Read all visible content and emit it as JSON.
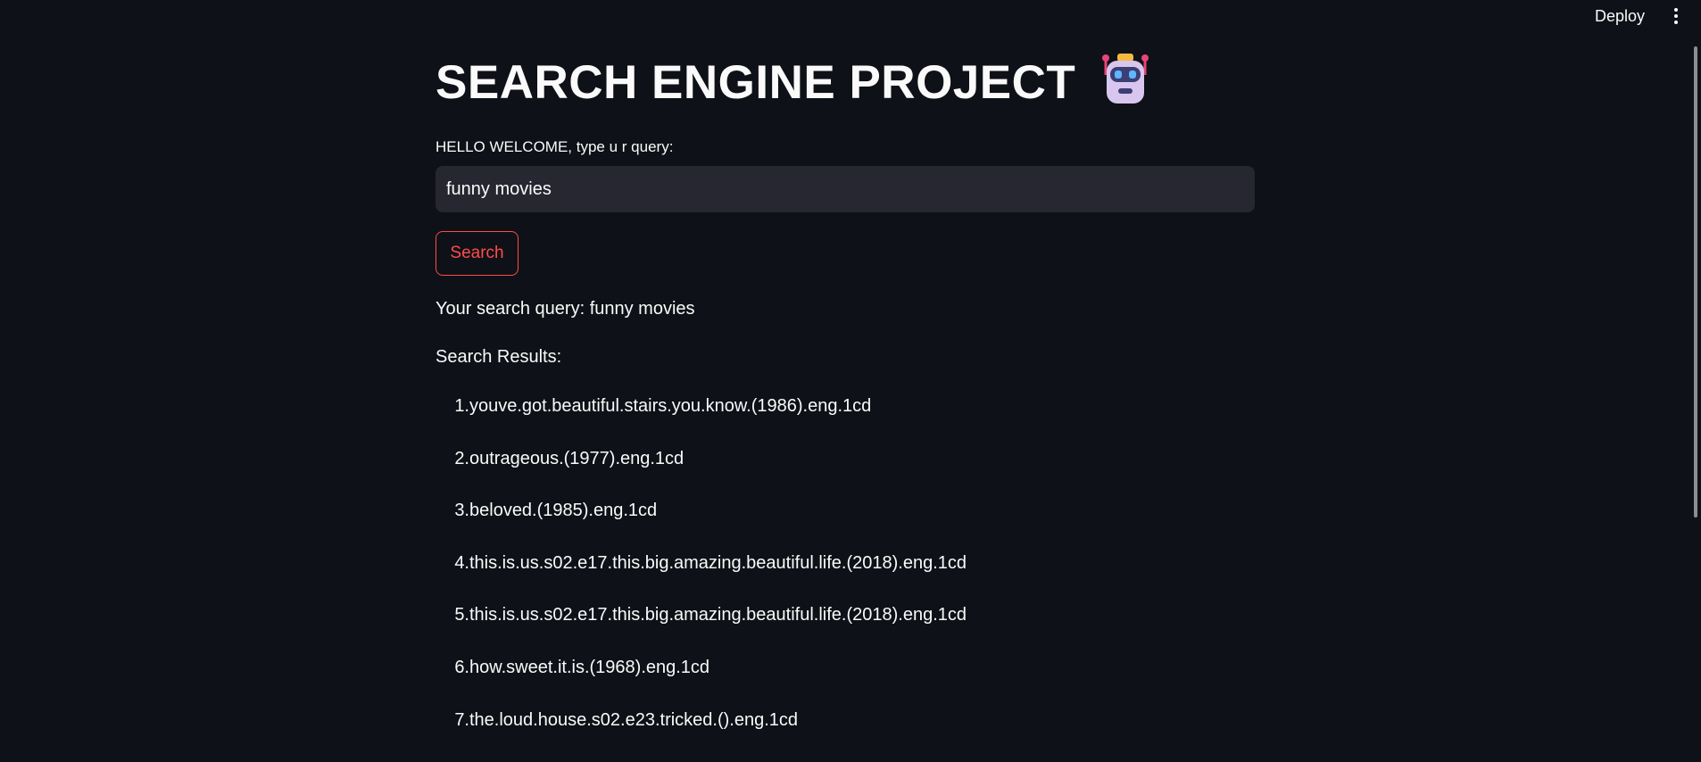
{
  "header": {
    "deploy_label": "Deploy",
    "menu_icon": "vertical-ellipsis-icon"
  },
  "main": {
    "title": "SEARCH ENGINE PROJECT",
    "title_icon": "robot-icon",
    "input_label": "HELLO WELCOME, type u r query:",
    "input_value": "funny movies",
    "search_button_label": "Search",
    "query_echo": "Your search query: funny movies",
    "results_heading": "Search Results:",
    "results": [
      {
        "num": "1.",
        "text": "youve.got.beautiful.stairs.you.know.(1986).eng.1cd"
      },
      {
        "num": "2.",
        "text": "outrageous.(1977).eng.1cd"
      },
      {
        "num": "3.",
        "text": "beloved.(1985).eng.1cd"
      },
      {
        "num": "4.",
        "text": "this.is.us.s02.e17.this.big.amazing.beautiful.life.(2018).eng.1cd"
      },
      {
        "num": "5.",
        "text": "this.is.us.s02.e17.this.big.amazing.beautiful.life.(2018).eng.1cd"
      },
      {
        "num": "6.",
        "text": "how.sweet.it.is.(1968).eng.1cd"
      },
      {
        "num": "7.",
        "text": "the.loud.house.s02.e23.tricked.().eng.1cd"
      }
    ]
  },
  "colors": {
    "background": "#0e1117",
    "text": "#fafafa",
    "input_bg": "#262730",
    "accent": "#ff4b4b"
  }
}
